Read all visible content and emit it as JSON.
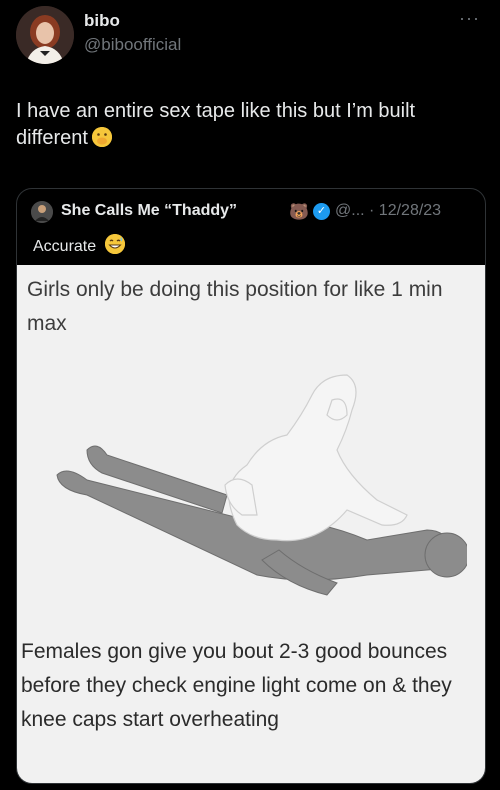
{
  "author": {
    "display_name": "bibo",
    "handle": "@biboofficial",
    "avatar_icon": "profile-photo"
  },
  "more_label": "···",
  "tweet": {
    "text": "I have an entire sex tape like this but I’m built different",
    "emoji_icon": "hand-over-mouth-emoji"
  },
  "quoted": {
    "display_name": "She Calls Me “Thaddy”",
    "bear_emoji": "🐻",
    "handle_date": "@... · 12/28/23",
    "text": "Accurate",
    "text_emoji_icon": "grinning-sweat-emoji",
    "media": {
      "top_text": "Girls only be doing this position for like 1 min max",
      "bottom_text": "Females gon give you bout 2-3 good bounces before they check engine light come on & they knee caps start overheating"
    }
  },
  "colors": {
    "background": "#000000",
    "text": "#e7e9ea",
    "secondary": "#71767b",
    "border": "#2f3336",
    "verified": "#1d9bf0"
  }
}
